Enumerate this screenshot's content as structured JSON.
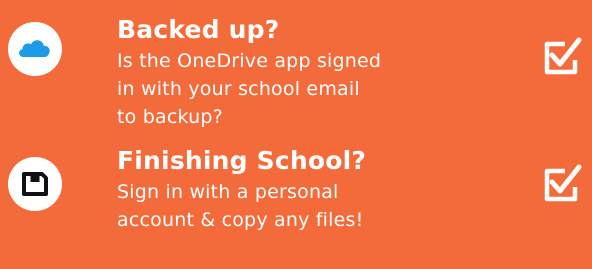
{
  "items": [
    {
      "title": "Backed up?",
      "description": "Is the OneDrive app signed in with your school email to backup?",
      "icon": "cloud-icon",
      "checked": true
    },
    {
      "title": "Finishing School?",
      "description": "Sign in with a personal account & copy any files!",
      "icon": "floppy-disk-icon",
      "checked": true
    }
  ],
  "colors": {
    "background": "#f36b3a",
    "cloud": "#1e9be6",
    "text": "#ffffff",
    "icon_dark": "#111111"
  }
}
